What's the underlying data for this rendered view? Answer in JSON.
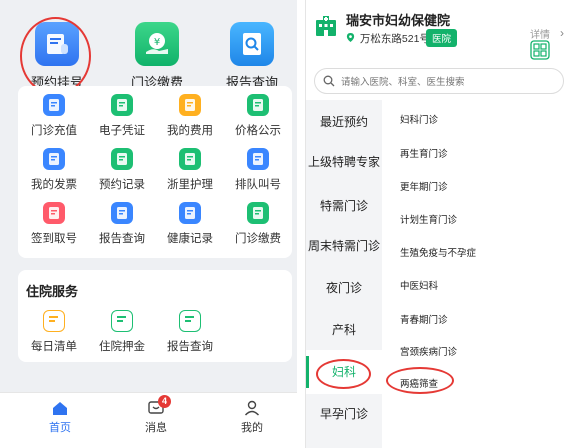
{
  "left": {
    "top_items": [
      {
        "label": "预约挂号",
        "icon": "appointment-icon"
      },
      {
        "label": "门诊缴费",
        "icon": "payment-icon"
      },
      {
        "label": "报告查询",
        "icon": "report-search-icon"
      }
    ],
    "grid": [
      {
        "label": "门诊充值",
        "icon": "recharge-icon",
        "color": "#3a86ff"
      },
      {
        "label": "电子凭证",
        "icon": "health-card-icon",
        "color": "#1dbf73"
      },
      {
        "label": "我的费用",
        "icon": "fee-icon",
        "color": "#ffb020"
      },
      {
        "label": "价格公示",
        "icon": "price-icon",
        "color": "#1dbf73"
      },
      {
        "label": "我的发票",
        "icon": "invoice-icon",
        "color": "#3a86ff"
      },
      {
        "label": "预约记录",
        "icon": "calendar-icon",
        "color": "#1dbf73"
      },
      {
        "label": "浙里护理",
        "icon": "nursing-icon",
        "color": "#1dbf73"
      },
      {
        "label": "排队叫号",
        "icon": "queue-icon",
        "color": "#3a86ff"
      },
      {
        "label": "签到取号",
        "icon": "checkin-icon",
        "color": "#ff5a6a"
      },
      {
        "label": "报告查询",
        "icon": "report-icon",
        "color": "#3a86ff"
      },
      {
        "label": "健康记录",
        "icon": "health-record-icon",
        "color": "#3a86ff"
      },
      {
        "label": "门诊缴费",
        "icon": "clinic-pay-icon",
        "color": "#1dbf73"
      }
    ],
    "inpatient": {
      "title": "住院服务",
      "items": [
        {
          "label": "每日清单",
          "icon": "daily-list-icon",
          "color": "#ffb020"
        },
        {
          "label": "住院押金",
          "icon": "deposit-icon",
          "color": "#1dbf73"
        },
        {
          "label": "报告查询",
          "icon": "inpatient-report-icon",
          "color": "#1dbf73"
        }
      ]
    },
    "tabs": [
      {
        "label": "首页",
        "icon": "home-icon"
      },
      {
        "label": "消息",
        "icon": "message-icon",
        "badge": "4"
      },
      {
        "label": "我的",
        "icon": "user-icon"
      }
    ]
  },
  "right": {
    "hospital_name": "瑞安市妇幼保健院",
    "address": "万松东路521号",
    "tag": "医院",
    "detail": "详情",
    "search_placeholder": "请输入医院、科室、医生搜索",
    "categories": [
      "最近预约",
      "上级特聘专家",
      "特需门诊",
      "周末特需门诊",
      "夜门诊",
      "产科",
      "妇科",
      "早孕门诊"
    ],
    "active_category": "妇科",
    "sub_departments": [
      "妇科门诊",
      "再生育门诊",
      "更年期门诊",
      "计划生育门诊",
      "生殖免疫与不孕症",
      "中医妇科",
      "青春期门诊",
      "宫颈疾病门诊",
      "两癌筛查"
    ]
  }
}
